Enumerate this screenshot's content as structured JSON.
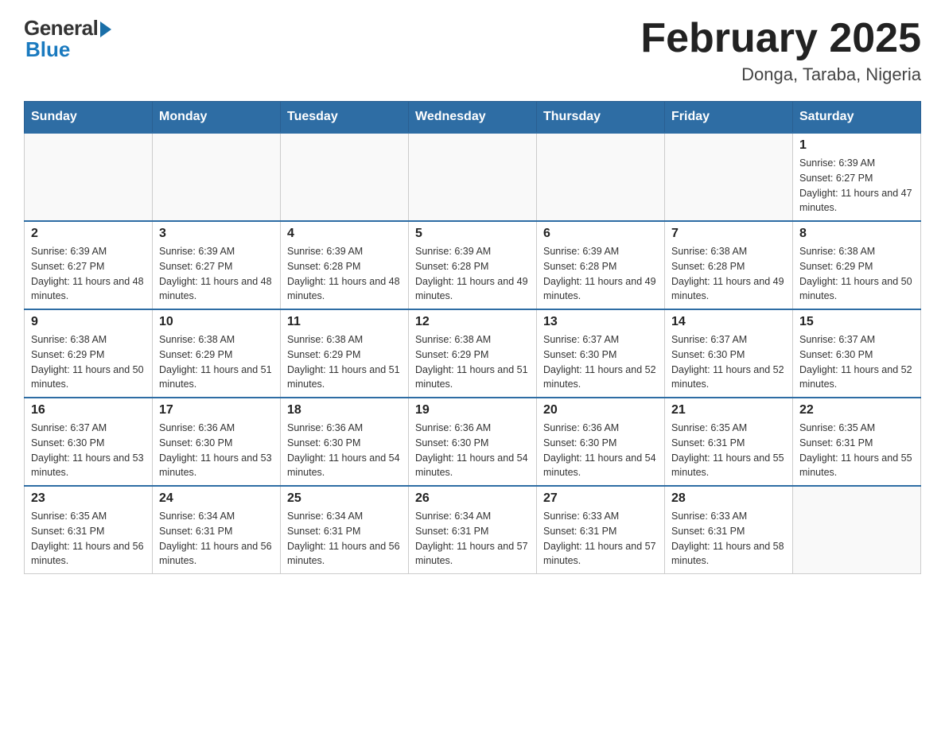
{
  "header": {
    "logo_general": "General",
    "logo_blue": "Blue",
    "month_title": "February 2025",
    "location": "Donga, Taraba, Nigeria"
  },
  "days_of_week": [
    "Sunday",
    "Monday",
    "Tuesday",
    "Wednesday",
    "Thursday",
    "Friday",
    "Saturday"
  ],
  "weeks": [
    [
      {
        "day": "",
        "info": ""
      },
      {
        "day": "",
        "info": ""
      },
      {
        "day": "",
        "info": ""
      },
      {
        "day": "",
        "info": ""
      },
      {
        "day": "",
        "info": ""
      },
      {
        "day": "",
        "info": ""
      },
      {
        "day": "1",
        "info": "Sunrise: 6:39 AM\nSunset: 6:27 PM\nDaylight: 11 hours and 47 minutes."
      }
    ],
    [
      {
        "day": "2",
        "info": "Sunrise: 6:39 AM\nSunset: 6:27 PM\nDaylight: 11 hours and 48 minutes."
      },
      {
        "day": "3",
        "info": "Sunrise: 6:39 AM\nSunset: 6:27 PM\nDaylight: 11 hours and 48 minutes."
      },
      {
        "day": "4",
        "info": "Sunrise: 6:39 AM\nSunset: 6:28 PM\nDaylight: 11 hours and 48 minutes."
      },
      {
        "day": "5",
        "info": "Sunrise: 6:39 AM\nSunset: 6:28 PM\nDaylight: 11 hours and 49 minutes."
      },
      {
        "day": "6",
        "info": "Sunrise: 6:39 AM\nSunset: 6:28 PM\nDaylight: 11 hours and 49 minutes."
      },
      {
        "day": "7",
        "info": "Sunrise: 6:38 AM\nSunset: 6:28 PM\nDaylight: 11 hours and 49 minutes."
      },
      {
        "day": "8",
        "info": "Sunrise: 6:38 AM\nSunset: 6:29 PM\nDaylight: 11 hours and 50 minutes."
      }
    ],
    [
      {
        "day": "9",
        "info": "Sunrise: 6:38 AM\nSunset: 6:29 PM\nDaylight: 11 hours and 50 minutes."
      },
      {
        "day": "10",
        "info": "Sunrise: 6:38 AM\nSunset: 6:29 PM\nDaylight: 11 hours and 51 minutes."
      },
      {
        "day": "11",
        "info": "Sunrise: 6:38 AM\nSunset: 6:29 PM\nDaylight: 11 hours and 51 minutes."
      },
      {
        "day": "12",
        "info": "Sunrise: 6:38 AM\nSunset: 6:29 PM\nDaylight: 11 hours and 51 minutes."
      },
      {
        "day": "13",
        "info": "Sunrise: 6:37 AM\nSunset: 6:30 PM\nDaylight: 11 hours and 52 minutes."
      },
      {
        "day": "14",
        "info": "Sunrise: 6:37 AM\nSunset: 6:30 PM\nDaylight: 11 hours and 52 minutes."
      },
      {
        "day": "15",
        "info": "Sunrise: 6:37 AM\nSunset: 6:30 PM\nDaylight: 11 hours and 52 minutes."
      }
    ],
    [
      {
        "day": "16",
        "info": "Sunrise: 6:37 AM\nSunset: 6:30 PM\nDaylight: 11 hours and 53 minutes."
      },
      {
        "day": "17",
        "info": "Sunrise: 6:36 AM\nSunset: 6:30 PM\nDaylight: 11 hours and 53 minutes."
      },
      {
        "day": "18",
        "info": "Sunrise: 6:36 AM\nSunset: 6:30 PM\nDaylight: 11 hours and 54 minutes."
      },
      {
        "day": "19",
        "info": "Sunrise: 6:36 AM\nSunset: 6:30 PM\nDaylight: 11 hours and 54 minutes."
      },
      {
        "day": "20",
        "info": "Sunrise: 6:36 AM\nSunset: 6:30 PM\nDaylight: 11 hours and 54 minutes."
      },
      {
        "day": "21",
        "info": "Sunrise: 6:35 AM\nSunset: 6:31 PM\nDaylight: 11 hours and 55 minutes."
      },
      {
        "day": "22",
        "info": "Sunrise: 6:35 AM\nSunset: 6:31 PM\nDaylight: 11 hours and 55 minutes."
      }
    ],
    [
      {
        "day": "23",
        "info": "Sunrise: 6:35 AM\nSunset: 6:31 PM\nDaylight: 11 hours and 56 minutes."
      },
      {
        "day": "24",
        "info": "Sunrise: 6:34 AM\nSunset: 6:31 PM\nDaylight: 11 hours and 56 minutes."
      },
      {
        "day": "25",
        "info": "Sunrise: 6:34 AM\nSunset: 6:31 PM\nDaylight: 11 hours and 56 minutes."
      },
      {
        "day": "26",
        "info": "Sunrise: 6:34 AM\nSunset: 6:31 PM\nDaylight: 11 hours and 57 minutes."
      },
      {
        "day": "27",
        "info": "Sunrise: 6:33 AM\nSunset: 6:31 PM\nDaylight: 11 hours and 57 minutes."
      },
      {
        "day": "28",
        "info": "Sunrise: 6:33 AM\nSunset: 6:31 PM\nDaylight: 11 hours and 58 minutes."
      },
      {
        "day": "",
        "info": ""
      }
    ]
  ]
}
